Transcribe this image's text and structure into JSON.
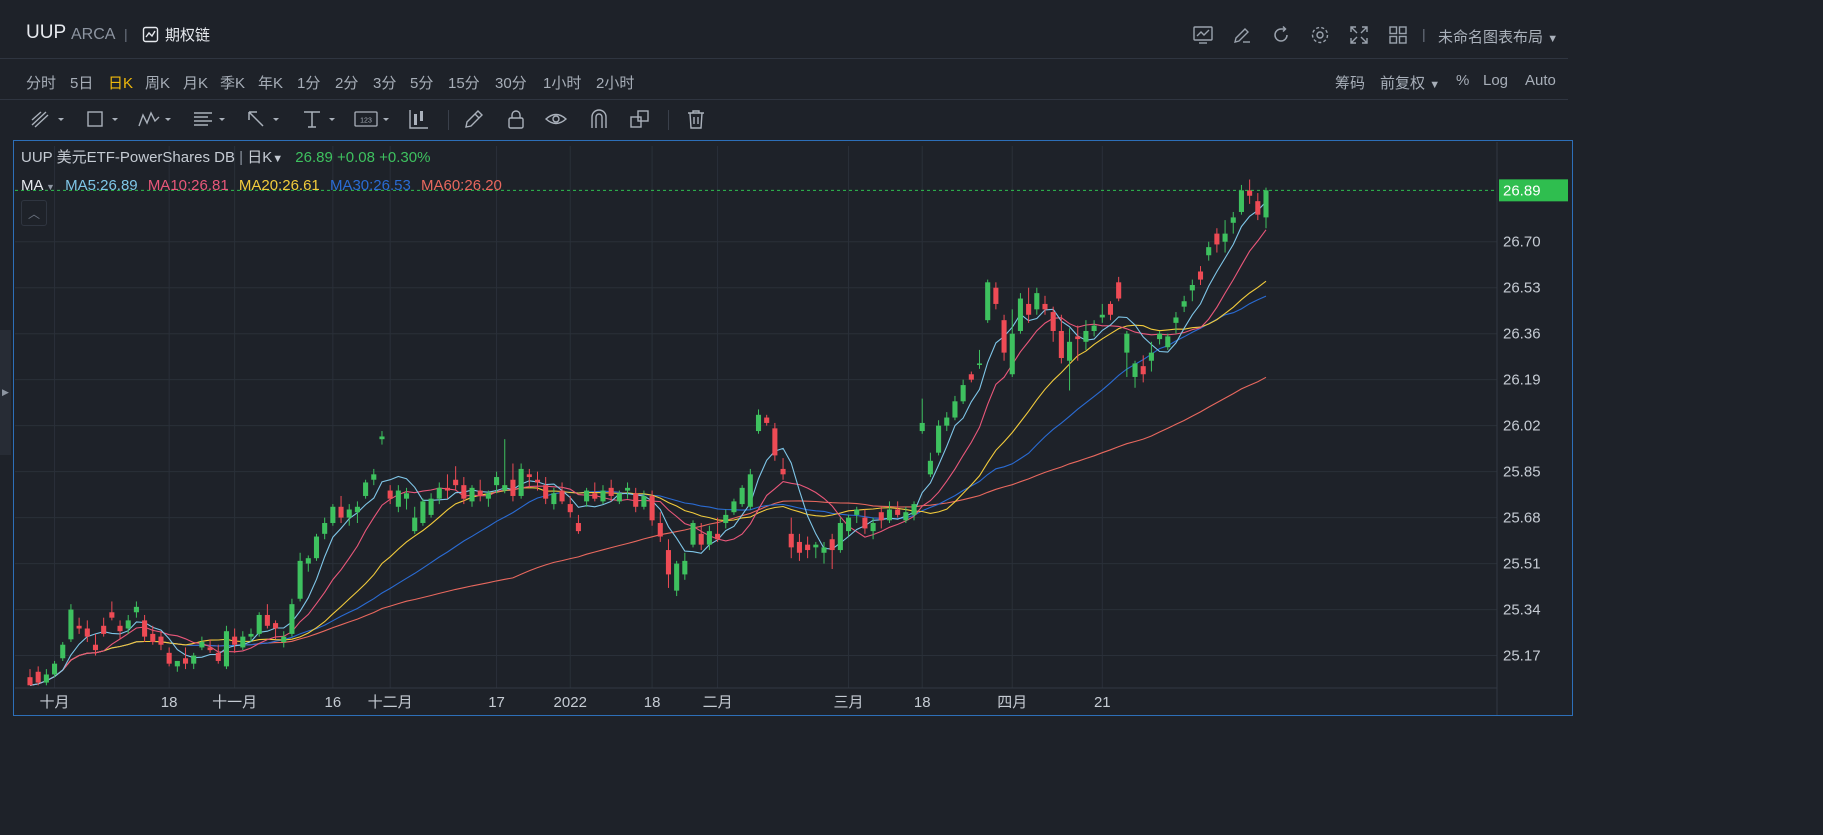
{
  "header": {
    "symbol": "UUP",
    "exchange": "ARCA",
    "option_chain_label": "期权链",
    "layout_name": "未命名图表布局",
    "icons": [
      "indicator-icon",
      "draw-icon",
      "refresh-icon",
      "gear-icon",
      "fullscreen-icon",
      "grid-layout-icon"
    ]
  },
  "periods": [
    "分时",
    "5日",
    "日K",
    "周K",
    "月K",
    "季K",
    "年K",
    "1分",
    "2分",
    "3分",
    "5分",
    "15分",
    "30分",
    "1小时",
    "2小时"
  ],
  "active_period": "日K",
  "right_options": {
    "chip": "筹码",
    "adjust": "前复权",
    "percent": "%",
    "log": "Log",
    "auto": "Auto"
  },
  "legend": {
    "symbol": "UUP",
    "name": "美元ETF-PowerShares DB",
    "period": "日K",
    "last": "26.89",
    "change": "+0.08",
    "change_pct": "+0.30%",
    "ma_label": "MA",
    "ma5": "MA5:26.89",
    "ma10": "MA10:26.81",
    "ma20": "MA20:26.61",
    "ma30": "MA30:26.53",
    "ma60": "MA60:26.20"
  },
  "colors": {
    "up": "#3ec15f",
    "down": "#ee4b55",
    "ma5": "#7fc6e8",
    "ma10": "#e9577a",
    "ma20": "#f2cb3c",
    "ma30": "#2a6bd3",
    "ma60": "#e8685e",
    "last_price_bg": "#2fbe4f"
  },
  "chart_data": {
    "type": "candlestick",
    "price_axis": {
      "ticks": [
        26.7,
        26.53,
        26.36,
        26.19,
        26.02,
        25.85,
        25.68,
        25.51,
        25.34,
        25.17
      ],
      "last_price_label": "26.89",
      "last_price": 26.89
    },
    "x_axis_labels": [
      "十月",
      "18",
      "十一月",
      "16",
      "十二月",
      "17",
      "2022",
      "18",
      "二月",
      "三月",
      "18",
      "四月",
      "21"
    ],
    "ylim": [
      25.05,
      26.98
    ],
    "candles": [
      [
        25.09,
        25.12,
        25.07,
        25.06
      ],
      [
        25.11,
        25.13,
        25.06,
        25.07
      ],
      [
        25.07,
        25.12,
        25.06,
        25.1
      ],
      [
        25.1,
        25.15,
        25.09,
        25.14
      ],
      [
        25.16,
        25.22,
        25.15,
        25.21
      ],
      [
        25.23,
        25.36,
        25.22,
        25.34
      ],
      [
        25.28,
        25.31,
        25.25,
        25.27
      ],
      [
        25.27,
        25.3,
        25.22,
        25.24
      ],
      [
        25.21,
        25.25,
        25.17,
        25.19
      ],
      [
        25.28,
        25.31,
        25.24,
        25.25
      ],
      [
        25.33,
        25.37,
        25.3,
        25.31
      ],
      [
        25.28,
        25.3,
        25.23,
        25.26
      ],
      [
        25.27,
        25.32,
        25.25,
        25.3
      ],
      [
        25.33,
        25.37,
        25.31,
        25.35
      ],
      [
        25.3,
        25.32,
        25.22,
        25.24
      ],
      [
        25.25,
        25.28,
        25.21,
        25.22
      ],
      [
        25.24,
        25.26,
        25.19,
        25.21
      ],
      [
        25.18,
        25.2,
        25.13,
        25.14
      ],
      [
        25.13,
        25.15,
        25.11,
        25.15
      ],
      [
        25.16,
        25.2,
        25.12,
        25.14
      ],
      [
        25.14,
        25.18,
        25.12,
        25.17
      ],
      [
        25.2,
        25.24,
        25.19,
        25.22
      ],
      [
        25.2,
        25.23,
        25.18,
        25.19
      ],
      [
        25.18,
        25.21,
        25.14,
        25.15
      ],
      [
        25.13,
        25.28,
        25.12,
        25.26
      ],
      [
        25.24,
        25.27,
        25.18,
        25.21
      ],
      [
        25.2,
        25.26,
        25.19,
        25.24
      ],
      [
        25.24,
        25.27,
        25.22,
        25.25
      ],
      [
        25.25,
        25.33,
        25.24,
        25.32
      ],
      [
        25.32,
        25.36,
        25.27,
        25.28
      ],
      [
        25.29,
        25.3,
        25.23,
        25.27
      ],
      [
        25.22,
        25.26,
        25.2,
        25.24
      ],
      [
        25.25,
        25.38,
        25.24,
        25.36
      ],
      [
        25.38,
        25.55,
        25.37,
        25.52
      ],
      [
        25.51,
        25.54,
        25.48,
        25.53
      ],
      [
        25.53,
        25.62,
        25.52,
        25.61
      ],
      [
        25.62,
        25.68,
        25.6,
        25.66
      ],
      [
        25.66,
        25.73,
        25.65,
        25.72
      ],
      [
        25.72,
        25.76,
        25.66,
        25.68
      ],
      [
        25.68,
        25.73,
        25.65,
        25.71
      ],
      [
        25.7,
        25.74,
        25.66,
        25.72
      ],
      [
        25.76,
        25.82,
        25.75,
        25.81
      ],
      [
        25.82,
        25.86,
        25.8,
        25.84
      ],
      [
        25.97,
        26.0,
        25.95,
        25.98
      ],
      [
        25.78,
        25.8,
        25.73,
        25.75
      ],
      [
        25.72,
        25.8,
        25.7,
        25.78
      ],
      [
        25.75,
        25.79,
        25.71,
        25.77
      ],
      [
        25.63,
        25.72,
        25.62,
        25.68
      ],
      [
        25.66,
        25.75,
        25.65,
        25.74
      ],
      [
        25.69,
        25.77,
        25.68,
        25.75
      ],
      [
        25.75,
        25.81,
        25.73,
        25.79
      ],
      [
        25.79,
        25.84,
        25.75,
        25.78
      ],
      [
        25.82,
        25.87,
        25.78,
        25.8
      ],
      [
        25.8,
        25.83,
        25.73,
        25.75
      ],
      [
        25.74,
        25.8,
        25.72,
        25.79
      ],
      [
        25.78,
        25.82,
        25.74,
        25.76
      ],
      [
        25.75,
        25.78,
        25.72,
        25.77
      ],
      [
        25.8,
        25.85,
        25.77,
        25.83
      ],
      [
        25.78,
        25.97,
        25.77,
        25.8
      ],
      [
        25.82,
        25.88,
        25.74,
        25.76
      ],
      [
        25.76,
        25.88,
        25.75,
        25.86
      ],
      [
        25.84,
        25.86,
        25.79,
        25.83
      ],
      [
        25.82,
        25.85,
        25.78,
        25.81
      ],
      [
        25.8,
        25.83,
        25.73,
        25.75
      ],
      [
        25.73,
        25.79,
        25.71,
        25.77
      ],
      [
        25.78,
        25.81,
        25.73,
        25.74
      ],
      [
        25.73,
        25.76,
        25.68,
        25.7
      ],
      [
        25.66,
        25.69,
        25.62,
        25.63
      ],
      [
        25.74,
        25.79,
        25.72,
        25.78
      ],
      [
        25.77,
        25.81,
        25.74,
        25.75
      ],
      [
        25.74,
        25.8,
        25.73,
        25.78
      ],
      [
        25.79,
        25.82,
        25.74,
        25.76
      ],
      [
        25.74,
        25.78,
        25.73,
        25.77
      ],
      [
        25.78,
        25.81,
        25.75,
        25.79
      ],
      [
        25.77,
        25.79,
        25.7,
        25.72
      ],
      [
        25.72,
        25.78,
        25.71,
        25.76
      ],
      [
        25.76,
        25.78,
        25.65,
        25.67
      ],
      [
        25.66,
        25.7,
        25.59,
        25.61
      ],
      [
        25.56,
        25.6,
        25.42,
        25.47
      ],
      [
        25.41,
        25.52,
        25.39,
        25.51
      ],
      [
        25.47,
        25.55,
        25.45,
        25.52
      ],
      [
        25.58,
        25.67,
        25.57,
        25.66
      ],
      [
        25.62,
        25.66,
        25.56,
        25.58
      ],
      [
        25.58,
        25.65,
        25.56,
        25.63
      ],
      [
        25.62,
        25.68,
        25.59,
        25.6
      ],
      [
        25.66,
        25.71,
        25.64,
        25.69
      ],
      [
        25.7,
        25.75,
        25.69,
        25.74
      ],
      [
        25.73,
        25.8,
        25.72,
        25.79
      ],
      [
        25.72,
        25.86,
        25.71,
        25.84
      ],
      [
        26.0,
        26.08,
        25.99,
        26.06
      ],
      [
        26.05,
        26.06,
        26.02,
        26.03
      ],
      [
        26.01,
        26.03,
        25.89,
        25.91
      ],
      [
        25.86,
        25.9,
        25.82,
        25.84
      ],
      [
        25.62,
        25.68,
        25.53,
        25.57
      ],
      [
        25.59,
        25.62,
        25.52,
        25.55
      ],
      [
        25.58,
        25.61,
        25.53,
        25.56
      ],
      [
        25.57,
        25.59,
        25.53,
        25.58
      ],
      [
        25.55,
        25.59,
        25.51,
        25.57
      ],
      [
        25.6,
        25.62,
        25.49,
        25.56
      ],
      [
        25.56,
        25.68,
        25.55,
        25.66
      ],
      [
        25.63,
        25.69,
        25.61,
        25.68
      ],
      [
        25.69,
        25.72,
        25.66,
        25.71
      ],
      [
        25.68,
        25.71,
        25.62,
        25.64
      ],
      [
        25.63,
        25.68,
        25.6,
        25.66
      ],
      [
        25.7,
        25.72,
        25.64,
        25.67
      ],
      [
        25.67,
        25.74,
        25.66,
        25.71
      ],
      [
        25.71,
        25.74,
        25.68,
        25.69
      ],
      [
        25.67,
        25.72,
        25.66,
        25.7
      ],
      [
        25.69,
        25.74,
        25.67,
        25.73
      ],
      [
        26.0,
        26.12,
        25.99,
        26.03
      ],
      [
        25.84,
        25.92,
        25.83,
        25.89
      ],
      [
        25.92,
        26.04,
        25.91,
        26.02
      ],
      [
        26.02,
        26.07,
        26.0,
        26.05
      ],
      [
        26.05,
        26.13,
        26.04,
        26.11
      ],
      [
        26.11,
        26.19,
        26.1,
        26.17
      ],
      [
        26.21,
        26.22,
        26.18,
        26.19
      ],
      [
        26.25,
        26.3,
        26.23,
        26.25
      ],
      [
        26.41,
        26.56,
        26.4,
        26.55
      ],
      [
        26.53,
        26.55,
        26.45,
        26.47
      ],
      [
        26.41,
        26.43,
        26.26,
        26.29
      ],
      [
        26.21,
        26.45,
        26.2,
        26.36
      ],
      [
        26.37,
        26.51,
        26.36,
        26.49
      ],
      [
        26.47,
        26.53,
        26.4,
        26.43
      ],
      [
        26.45,
        26.53,
        26.43,
        26.51
      ],
      [
        26.47,
        26.5,
        26.43,
        26.45
      ],
      [
        26.44,
        26.46,
        26.33,
        26.37
      ],
      [
        26.37,
        26.43,
        26.25,
        26.27
      ],
      [
        26.26,
        26.38,
        26.15,
        26.33
      ],
      [
        26.35,
        26.39,
        26.26,
        26.34
      ],
      [
        26.33,
        26.41,
        26.3,
        26.37
      ],
      [
        26.37,
        26.41,
        26.35,
        26.39
      ],
      [
        26.42,
        26.47,
        26.4,
        26.43
      ],
      [
        26.47,
        26.48,
        26.41,
        26.43
      ],
      [
        26.55,
        26.57,
        26.48,
        26.49
      ],
      [
        26.29,
        26.37,
        26.2,
        26.36
      ],
      [
        26.2,
        26.26,
        26.16,
        26.25
      ],
      [
        26.24,
        26.28,
        26.18,
        26.21
      ],
      [
        26.26,
        26.33,
        26.22,
        26.29
      ],
      [
        26.34,
        26.37,
        26.32,
        26.36
      ],
      [
        26.31,
        26.36,
        26.3,
        26.35
      ],
      [
        26.4,
        26.44,
        26.36,
        26.42
      ],
      [
        26.46,
        26.5,
        26.44,
        26.48
      ],
      [
        26.52,
        26.56,
        26.48,
        26.54
      ],
      [
        26.59,
        26.61,
        26.54,
        26.56
      ],
      [
        26.65,
        26.7,
        26.63,
        26.68
      ],
      [
        26.73,
        26.75,
        26.66,
        26.69
      ],
      [
        26.7,
        26.78,
        26.66,
        26.73
      ],
      [
        26.77,
        26.81,
        26.73,
        26.79
      ],
      [
        26.81,
        26.91,
        26.8,
        26.89
      ],
      [
        26.89,
        26.93,
        26.84,
        26.87
      ],
      [
        26.85,
        26.88,
        26.78,
        26.8
      ],
      [
        26.79,
        26.9,
        26.75,
        26.89
      ]
    ]
  }
}
